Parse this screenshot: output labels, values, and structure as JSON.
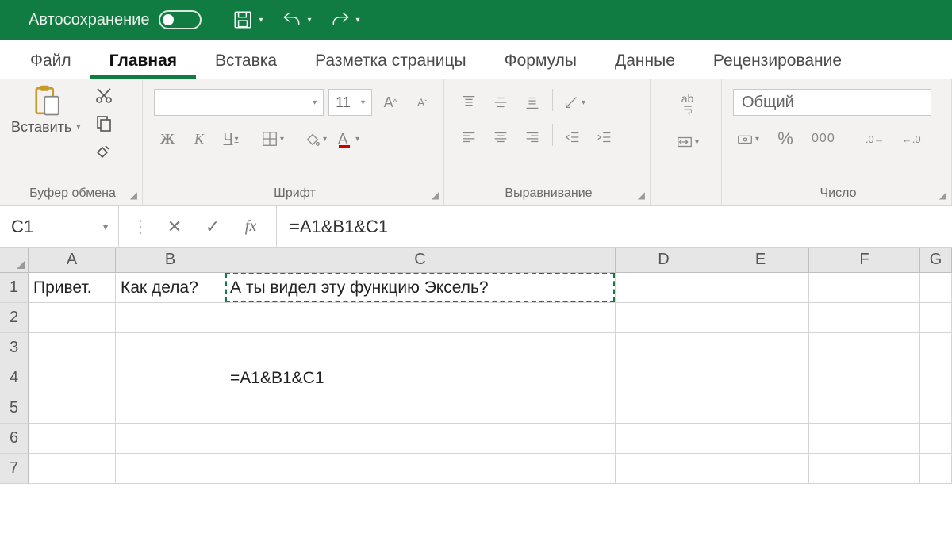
{
  "titlebar": {
    "autosave_label": "Автосохранение"
  },
  "tabs": {
    "file": "Файл",
    "home": "Главная",
    "insert": "Вставка",
    "layout": "Разметка страницы",
    "formulas": "Формулы",
    "data": "Данные",
    "review": "Рецензирование"
  },
  "ribbon": {
    "clipboard": {
      "paste": "Вставить",
      "group": "Буфер обмена"
    },
    "font": {
      "group": "Шрифт",
      "size": "11",
      "bold": "Ж",
      "italic": "К",
      "underline": "Ч"
    },
    "alignment": {
      "group": "Выравнивание"
    },
    "wrap": {
      "label": "ab"
    },
    "number": {
      "group": "Число",
      "format": "Общий",
      "percent": "%",
      "thousands": "000"
    }
  },
  "formula_bar": {
    "name_box": "C1",
    "fx": "fx",
    "formula": "=A1&B1&C1"
  },
  "columns": [
    "A",
    "B",
    "C",
    "D",
    "E",
    "F",
    "G"
  ],
  "rows": [
    {
      "n": "1",
      "A": "Привет.",
      "B": "Как дела?",
      "C": "А ты видел эту функцию Эксель?"
    },
    {
      "n": "2"
    },
    {
      "n": "3"
    },
    {
      "n": "4",
      "C": "=A1&B1&C1"
    },
    {
      "n": "5"
    },
    {
      "n": "6"
    },
    {
      "n": "7"
    }
  ]
}
